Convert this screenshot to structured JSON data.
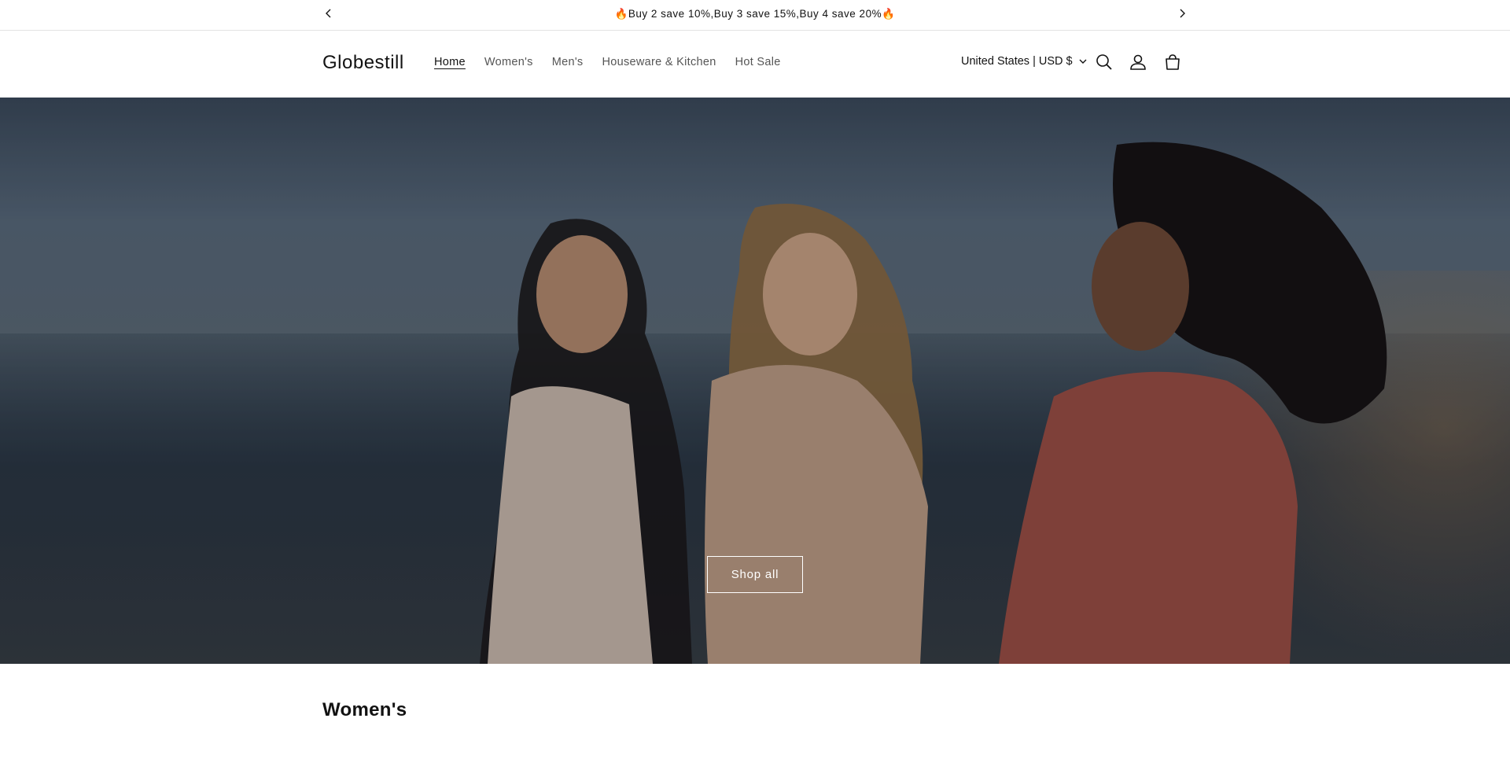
{
  "announcement": {
    "text": "🔥Buy 2 save 10%,Buy 3 save 15%,Buy 4 save 20%🔥",
    "prev_icon": "chevron-left-icon",
    "next_icon": "chevron-right-icon"
  },
  "header": {
    "logo": "Globestill",
    "nav": [
      {
        "label": "Home",
        "active": true
      },
      {
        "label": "Women's",
        "active": false
      },
      {
        "label": "Men's",
        "active": false
      },
      {
        "label": "Houseware & Kitchen",
        "active": false
      },
      {
        "label": "Hot Sale",
        "active": false
      }
    ],
    "locale": "United States | USD $",
    "icons": [
      "search-icon",
      "account-icon",
      "cart-icon"
    ]
  },
  "hero": {
    "button_label": "Shop all"
  },
  "sections": {
    "first_title": "Women's"
  },
  "colors": {
    "text": "#121212",
    "nav_muted": "#555555",
    "border": "#e3e3e3"
  }
}
